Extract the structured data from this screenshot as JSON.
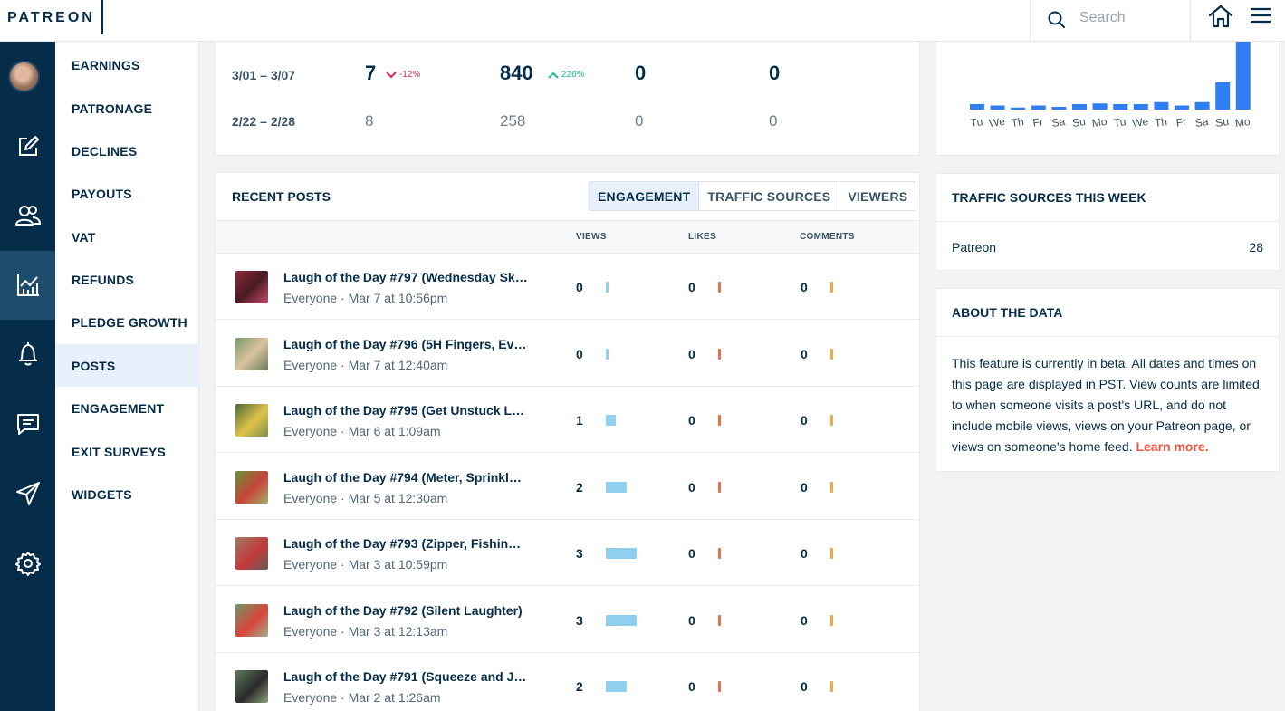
{
  "header": {
    "logo": "PATREON",
    "search_placeholder": "Search"
  },
  "rail": {
    "icons": [
      "avatar",
      "pencil-edit-icon",
      "people-icon",
      "analytics-chart-icon",
      "bell-icon",
      "message-icon",
      "send-icon",
      "gear-icon"
    ],
    "active": "analytics-chart-icon"
  },
  "subnav": {
    "items": [
      {
        "label": "EARNINGS"
      },
      {
        "label": "PATRONAGE"
      },
      {
        "label": "DECLINES"
      },
      {
        "label": "PAYOUTS"
      },
      {
        "label": "VAT"
      },
      {
        "label": "REFUNDS"
      },
      {
        "label": "PLEDGE GROWTH"
      },
      {
        "label": "POSTS"
      },
      {
        "label": "ENGAGEMENT"
      },
      {
        "label": "EXIT SURVEYS"
      },
      {
        "label": "WIDGETS"
      }
    ],
    "active": "POSTS"
  },
  "stats": {
    "rows": [
      {
        "label": "3/01 – 3/07",
        "v1": "7",
        "v1_delta": "-12%",
        "v2": "840",
        "v2_delta": "226%",
        "v3": "0",
        "v4": "0"
      },
      {
        "label": "2/22 – 2/28",
        "v1": "8",
        "v2": "258",
        "v3": "0",
        "v4": "0"
      }
    ]
  },
  "posts": {
    "title": "RECENT POSTS",
    "tabs": [
      "ENGAGEMENT",
      "TRAFFIC SOURCES",
      "VIEWERS"
    ],
    "active_tab": "ENGAGEMENT",
    "columns": [
      "VIEWS",
      "LIKES",
      "COMMENTS"
    ],
    "rows": [
      {
        "title": "Laugh of the Day #797 (Wednesday Sk…",
        "meta": "Everyone · Mar 7 at 10:56pm",
        "views": "0",
        "likes": "0",
        "comments": "0",
        "views_fraction": 0
      },
      {
        "title": "Laugh of the Day #796 (5H Fingers, Ev…",
        "meta": "Everyone · Mar 7 at 12:40am",
        "views": "0",
        "likes": "0",
        "comments": "0",
        "views_fraction": 0
      },
      {
        "title": "Laugh of the Day #795 (Get Unstuck L…",
        "meta": "Everyone · Mar 6 at 1:09am",
        "views": "1",
        "likes": "0",
        "comments": "0",
        "views_fraction": 0.33
      },
      {
        "title": "Laugh of the Day #794 (Meter, Sprinkl…",
        "meta": "Everyone · Mar 5 at 12:30am",
        "views": "2",
        "likes": "0",
        "comments": "0",
        "views_fraction": 0.67
      },
      {
        "title": "Laugh of the Day #793 (Zipper, Fishin…",
        "meta": "Everyone · Mar 3 at 10:59pm",
        "views": "3",
        "likes": "0",
        "comments": "0",
        "views_fraction": 1
      },
      {
        "title": "Laugh of the Day #792 (Silent Laughter)",
        "meta": "Everyone · Mar 3 at 12:13am",
        "views": "3",
        "likes": "0",
        "comments": "0",
        "views_fraction": 1
      },
      {
        "title": "Laugh of the Day #791 (Squeeze and J…",
        "meta": "Everyone · Mar 2 at 1:26am",
        "views": "2",
        "likes": "0",
        "comments": "0",
        "views_fraction": 0.67
      }
    ]
  },
  "chart_data": {
    "type": "bar",
    "categories": [
      "Tu",
      "We",
      "Th",
      "Fr",
      "Sa",
      "Su",
      "Mo",
      "Tu",
      "We",
      "Th",
      "Fr",
      "Sa",
      "Su",
      "Mo"
    ],
    "values": [
      8,
      6,
      3,
      6,
      4,
      8,
      9,
      8,
      8,
      11,
      6,
      11,
      40,
      100
    ],
    "color": "#2f7ef3"
  },
  "traffic": {
    "title": "TRAFFIC SOURCES THIS WEEK",
    "source": "Patreon",
    "count": "28"
  },
  "about": {
    "title": "ABOUT THE DATA",
    "text": "This feature is currently in beta. All dates and times on this page are displayed in PST. View counts are limited to when someone visits a post's URL, and do not include mobile views, views on your Patreon page, or views on someone's home feed.",
    "link": "Learn more."
  }
}
